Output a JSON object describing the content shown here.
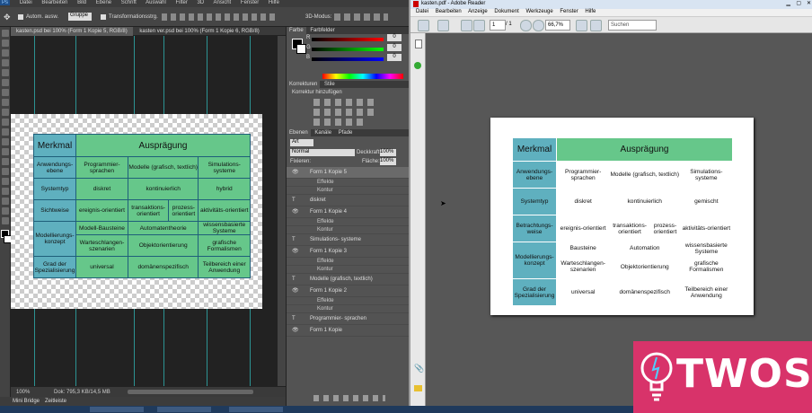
{
  "photoshop": {
    "menu": [
      "Datei",
      "Bearbeiten",
      "Bild",
      "Ebene",
      "Schrift",
      "Auswahl",
      "Filter",
      "3D",
      "Ansicht",
      "Fenster",
      "Hilfe"
    ],
    "options": {
      "auto_select": "Autom. ausw.",
      "group": "Gruppe",
      "transform": "Transformationsstrg.",
      "mode_3d": "3D-Modus:"
    },
    "tabs": [
      "kasten.psd bei 100% (Form 1 Kopie 5, RGB/8)",
      "kasten ver.psd bei 100% (Form 1 Kopie 6, RGB/8)"
    ],
    "status": {
      "zoom": "100%",
      "doc": "Dok: 795,3 KB/14,5 MB"
    },
    "bottom_tabs": [
      "Mini Bridge",
      "Zeitleiste"
    ],
    "panels": {
      "color_tabs": [
        "Farbe",
        "Farbfelder"
      ],
      "sliders": [
        {
          "label": "R",
          "value": "0"
        },
        {
          "label": "G",
          "value": "0"
        },
        {
          "label": "B",
          "value": "0"
        }
      ],
      "adjust_tabs": [
        "Korrekturen",
        "Stile"
      ],
      "adjust_title": "Korrektur hinzufügen",
      "layer_tabs": [
        "Ebenen",
        "Kanäle",
        "Pfade"
      ],
      "kind": "Art",
      "blend_mode": "Normal",
      "opacity_label": "Deckkraft:",
      "opacity": "100%",
      "lock_label": "Fixieren:",
      "fill_label": "Fläche:",
      "fill": "100%",
      "layers": [
        {
          "name": "Form 1 Kopie 5",
          "type": "shape",
          "selected": true
        },
        {
          "name": "Effekte",
          "type": "sub"
        },
        {
          "name": "Kontur",
          "type": "sub"
        },
        {
          "name": "diskret",
          "type": "text"
        },
        {
          "name": "Form 1 Kopie 4",
          "type": "shape"
        },
        {
          "name": "Effekte",
          "type": "sub"
        },
        {
          "name": "Kontur",
          "type": "sub"
        },
        {
          "name": "Simulations- systeme",
          "type": "text"
        },
        {
          "name": "Form 1 Kopie 3",
          "type": "shape"
        },
        {
          "name": "Effekte",
          "type": "sub"
        },
        {
          "name": "Kontur",
          "type": "sub"
        },
        {
          "name": "Modelle (grafisch, textlich)",
          "type": "text"
        },
        {
          "name": "Form 1 Kopie 2",
          "type": "shape"
        },
        {
          "name": "Effekte",
          "type": "sub"
        },
        {
          "name": "Kontur",
          "type": "sub"
        },
        {
          "name": "Programmier- sprachen",
          "type": "text"
        },
        {
          "name": "Form 1 Kopie",
          "type": "shape"
        }
      ]
    }
  },
  "table": {
    "header": [
      "Merkmal",
      "Ausprägung"
    ],
    "rows": [
      {
        "label": "Anwendungs-ebene",
        "cells": [
          "Programmier-sprachen",
          "Modelle (grafisch, textlich)",
          "Simulations-systeme"
        ]
      },
      {
        "label": "Systemtyp",
        "cells": [
          "diskret",
          "kontinuierlich",
          "hybrid"
        ]
      },
      {
        "label": "Sichtweise",
        "cells": [
          "ereignis-orientiert",
          "transaktions-orientiert",
          "prozess-orientiert",
          "aktivitäts-orientiert"
        ]
      },
      {
        "label": "Modellierungs-konzept",
        "cells": [
          "Modell-Bausteine",
          "Automatentheorie",
          "wissensbasierte Systeme"
        ]
      },
      {
        "label": "",
        "cells": [
          "Warteschlangen-szenarien",
          "Objektorientierung",
          "grafische Formalismen"
        ]
      },
      {
        "label": "Grad der Spezialisierung",
        "cells": [
          "universal",
          "domänenspezifisch",
          "Teilbereich einer Anwendung"
        ]
      }
    ]
  },
  "reader": {
    "title": "kasten.pdf - Adobe Reader",
    "menu": [
      "Datei",
      "Bearbeiten",
      "Anzeige",
      "Dokument",
      "Werkzeuge",
      "Fenster",
      "Hilfe"
    ],
    "page_current": "1",
    "page_total": "/ 1",
    "zoom": "66,7%",
    "search_placeholder": "Suchen",
    "pdf_table": {
      "rows": [
        {
          "label": "Anwendungs-ebene",
          "cells": [
            "Programmier-sprachen",
            "Modelle (grafisch, textlich)",
            "Simulations-systeme"
          ]
        },
        {
          "label": "Systemtyp",
          "cells": [
            "diskret",
            "kontinuierlich",
            "gemischt"
          ]
        },
        {
          "label": "Betrachtungs-weise",
          "cells": [
            "ereignis-orientiert",
            "transaktions-orientiert",
            "prozess-orientiert",
            "aktivitäts-orientiert"
          ]
        },
        {
          "label": "Modellierungs-konzept",
          "cells": [
            "Bausteine",
            "Automation",
            "wissensbasierte Systeme"
          ]
        },
        {
          "label": "",
          "cells": [
            "Warteschlangen-szenarien",
            "Objektorientierung",
            "grafische Formalismen"
          ]
        },
        {
          "label": "Grad der Spezialisierung",
          "cells": [
            "universal",
            "domänenspezifisch",
            "Teilbereich einer Anwendung"
          ]
        }
      ]
    }
  },
  "watermark": {
    "brand": "TWOS",
    "color": "#d8336a"
  }
}
